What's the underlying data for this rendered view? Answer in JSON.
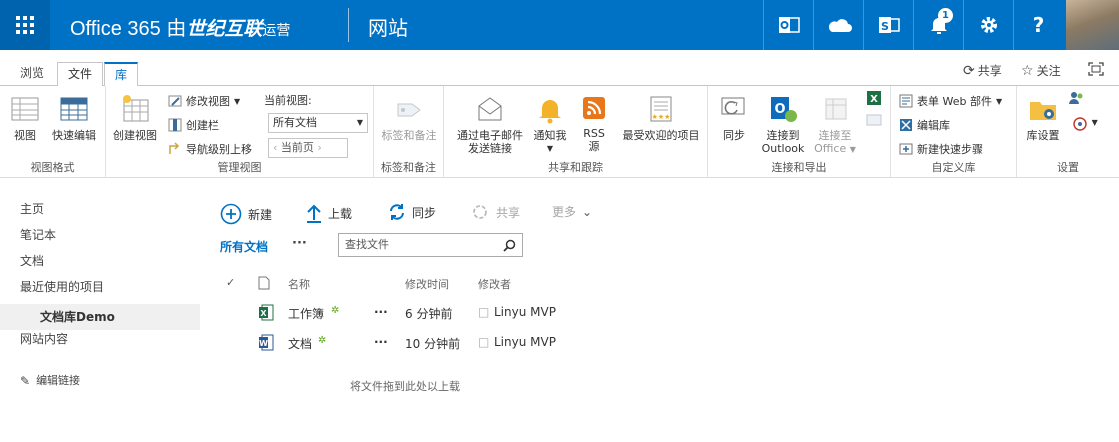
{
  "suite": {
    "brand": "Office 365 由",
    "brand_suffix": "世纪互联",
    "brand_tail": "运营",
    "site_title": "网站",
    "notification_count": "1",
    "colors": {
      "suite_bar": "#0072c6",
      "waffle": "#0063ad",
      "accent": "#0072c6"
    }
  },
  "ribbon_tabs": {
    "browse": "浏览",
    "files": "文件",
    "library": "库"
  },
  "ribbon_tools": {
    "share": "共享",
    "follow": "关注"
  },
  "ribbon": {
    "view_format": {
      "view": "视图",
      "quick_edit": "快速编辑",
      "label": "视图格式"
    },
    "manage_views": {
      "create_view": "创建视图",
      "modify_view": "修改视图",
      "create_column": "创建栏",
      "navigate_up": "导航级别上移",
      "current_view_label": "当前视图:",
      "current_view_value": "所有文档",
      "current_page": "当前页",
      "label": "管理视图"
    },
    "tags": {
      "tags_notes": "标签和备注",
      "label": "标签和备注"
    },
    "share_track": {
      "email_link_1": "通过电子邮件",
      "email_link_2": "发送链接",
      "alert_me": "通知我",
      "rss_1": "RSS",
      "rss_2": "源",
      "most_popular": "最受欢迎的项目",
      "label": "共享和跟踪"
    },
    "connect_export": {
      "sync": "同步",
      "connect_outlook_1": "连接到",
      "connect_outlook_2": "Outlook",
      "connect_office_1": "连接至",
      "connect_office_2": "Office",
      "label": "连接和导出"
    },
    "customize": {
      "form_web_parts": "表单 Web 部件",
      "edit_library": "编辑库",
      "new_quick_step": "新建快速步骤",
      "label": "自定义库"
    },
    "settings": {
      "library_settings": "库设置",
      "label": "设置"
    }
  },
  "left_nav": {
    "items": [
      "主页",
      "笔记本",
      "文档",
      "最近使用的项目",
      "文档库Demo",
      "网站内容"
    ],
    "edit_links": "编辑链接"
  },
  "commands": {
    "new": "新建",
    "upload": "上载",
    "sync": "同步",
    "share": "共享",
    "more": "更多"
  },
  "view_bar": {
    "all_documents": "所有文档",
    "ellipsis": "···",
    "search_placeholder": "查找文件"
  },
  "list": {
    "headers": {
      "name": "名称",
      "modified": "修改时间",
      "modified_by": "修改者"
    },
    "rows": [
      {
        "name": "工作簿",
        "modified": "6 分钟前",
        "modified_by": "Linyu MVP",
        "ellipsis": "···",
        "new_mark": "✲"
      },
      {
        "name": "文档",
        "modified": "10 分钟前",
        "modified_by": "Linyu MVP",
        "ellipsis": "···",
        "new_mark": "✲"
      }
    ],
    "drop_hint": "将文件拖到此处以上载"
  }
}
